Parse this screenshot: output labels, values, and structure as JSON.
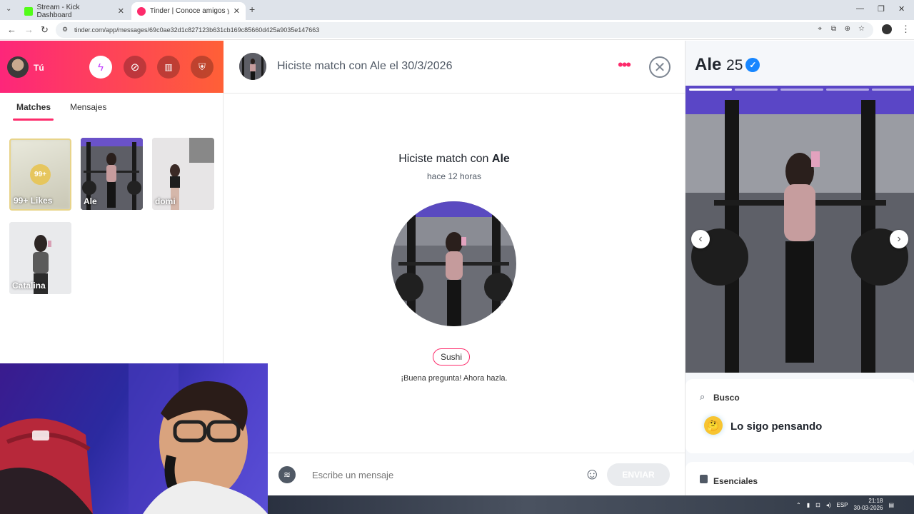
{
  "browser": {
    "tabs": [
      {
        "label": "Stream - Kick Dashboard",
        "color": "#53fc18"
      },
      {
        "label": "Tinder | Conoce amigos y gente",
        "color": "#fd2b6b"
      }
    ],
    "url": "tinder.com/app/messages/69c0ae32d1c827123b631cb169c85660d425a9035e147663"
  },
  "sidebar": {
    "user_label": "Tú",
    "tabs": [
      "Matches",
      "Mensajes"
    ],
    "likes": {
      "count": "99+",
      "label": "99+ Likes"
    },
    "matches": [
      "Ale",
      "domi",
      "Catalina"
    ]
  },
  "chat": {
    "header_title": "Hiciste match con Ale el 30/3/2026",
    "match_prefix": "Hiciste match con ",
    "match_name": "Ale",
    "match_time": "hace 12 horas",
    "chip": "Sushi",
    "prompt": "¡Buena pregunta! Ahora hazla.",
    "input_placeholder": "Escribe un mensaje",
    "send_label": "ENVIAR"
  },
  "profile": {
    "name": "Ale",
    "age": "25",
    "busco_label": "Busco",
    "busco_value": "Lo sigo pensando",
    "esenciales_label": "Esenciales"
  },
  "taskbar": {
    "lang": "ESP",
    "time": "21:18",
    "date": "30-03-2026"
  },
  "colors": {
    "brand_start": "#fd267a",
    "brand_end": "#ff6036",
    "accent": "#fd2b6b",
    "verified": "#1786ff"
  }
}
